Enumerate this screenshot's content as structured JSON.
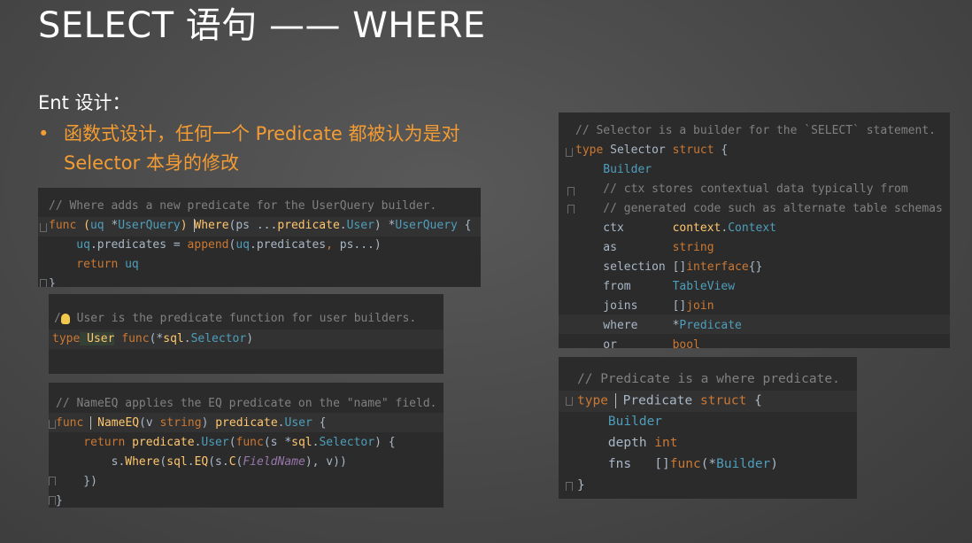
{
  "slide": {
    "title": "SELECT 语句 —— WHERE",
    "subheading": "Ent 设计：",
    "bullet_dot": "•",
    "bullet_line1": "函数式设计，任何一个 Predicate 都被认为是对",
    "bullet_line2": "Selector 本身的修改",
    "accent_color": "#f39c33"
  },
  "code_where": {
    "l1": "// Where adds a new predicate for the UserQuery builder.",
    "l2_kw": "func",
    "l2_a": " (",
    "l2_b": "uq",
    "l2_c": " *",
    "l2_d": "UserQuery",
    "l2_e": ") ",
    "l2_f": "Where",
    "l2_g": "(ps ...",
    "l2_h": "predicate",
    "l2_i": ".",
    "l2_j": "User",
    "l2_k": ") *",
    "l2_l": "UserQuery",
    "l2_m": " {",
    "l3_a": "    uq",
    "l3_b": ".predicates = ",
    "l3_c": "append",
    "l3_d": "(",
    "l3_e": "uq",
    "l3_f": ".predicates",
    "l3_g": ", ",
    "l3_h": "ps...)",
    "l4_kw": "    return",
    "l4_a": " uq",
    "l5": "}"
  },
  "code_user": {
    "l1": " User is the predicate function for user builders.",
    "l2_kw": "type",
    "l2_a": " User",
    "l2_b": " func",
    "l2_c": "(*",
    "l2_d": "sql",
    "l2_e": ".",
    "l2_f": "Selector",
    "l2_g": ")"
  },
  "code_nameeq": {
    "l1": "// NameEQ applies the EQ predicate on the \"name\" field.",
    "l2_kw": "func",
    "l2_a": " NameEQ",
    "l2_b": "(v ",
    "l2_c": "string",
    "l2_d": ") ",
    "l2_e": "predicate",
    "l2_f": ".",
    "l2_g": "User",
    "l2_h": " {",
    "l3_kw": "    return",
    "l3_a": " predicate",
    "l3_b": ".",
    "l3_c": "User",
    "l3_d": "(",
    "l3_e": "func",
    "l3_f": "(s *",
    "l3_g": "sql",
    "l3_h": ".",
    "l3_i": "Selector",
    "l3_j": ") {",
    "l4_a": "        s.",
    "l4_b": "Where",
    "l4_c": "(",
    "l4_d": "sql",
    "l4_e": ".",
    "l4_f": "EQ",
    "l4_g": "(s.",
    "l4_h": "C",
    "l4_i": "(",
    "l4_j": "FieldName",
    "l4_k": "), v))",
    "l5": "    })",
    "l6": "}"
  },
  "code_selector": {
    "l1": "// Selector is a builder for the `SELECT` statement.",
    "l2_kw": "type",
    "l2_a": " Selector ",
    "l2_b": "struct",
    "l2_c": " {",
    "l3": "    Builder",
    "l4": "    // ctx stores contextual data typically from",
    "l5": "    // generated code such as alternate table schemas",
    "fields": [
      {
        "name": "    ctx       ",
        "type_pkg": "context",
        "type_dot": ".",
        "type_name": "Context"
      },
      {
        "name": "    as        ",
        "type_pkg": "",
        "type_dot": "",
        "type_name": "string"
      },
      {
        "name": "    selection ",
        "type_pkg": "[]",
        "type_dot": "",
        "type_name": "interface",
        "suffix": "{}"
      },
      {
        "name": "    from      ",
        "type_pkg": "",
        "type_dot": "",
        "type_name": "TableView"
      },
      {
        "name": "    joins     ",
        "type_pkg": "[]",
        "type_dot": "",
        "type_name": "join"
      },
      {
        "name": "    where     ",
        "type_pkg": "*",
        "type_dot": "",
        "type_name": "Predicate"
      },
      {
        "name": "    or        ",
        "type_pkg": "",
        "type_dot": "",
        "type_name": "bool"
      }
    ]
  },
  "code_predicate": {
    "l1": "// Predicate is a where predicate.",
    "l2_kw": "type",
    "l2_a": " Predicate",
    "l2_b": " struct",
    "l2_c": " {",
    "l3": "    Builder",
    "l4_a": "    depth",
    "l4_b": " int",
    "l5_a": "    fns   ",
    "l5_b": "[]",
    "l5_c": "func",
    "l5_d": "(*",
    "l5_e": "Builder",
    "l5_f": ")",
    "l6": "}"
  }
}
